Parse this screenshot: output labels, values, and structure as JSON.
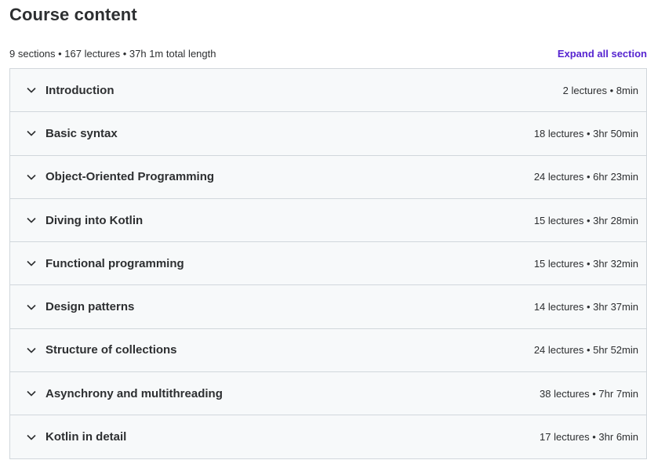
{
  "header": {
    "title": "Course content",
    "summary": "9 sections • 167 lectures • 37h 1m total length",
    "expand_label": "Expand all section"
  },
  "sections": [
    {
      "title": "Introduction",
      "meta": "2 lectures • 8min"
    },
    {
      "title": "Basic syntax",
      "meta": "18 lectures • 3hr 50min"
    },
    {
      "title": "Object-Oriented Programming",
      "meta": "24 lectures • 6hr 23min"
    },
    {
      "title": "Diving into Kotlin",
      "meta": "15 lectures • 3hr 28min"
    },
    {
      "title": "Functional programming",
      "meta": "15 lectures • 3hr 32min"
    },
    {
      "title": "Design patterns",
      "meta": "14 lectures • 3hr 37min"
    },
    {
      "title": "Structure of collections",
      "meta": "24 lectures • 5hr 52min"
    },
    {
      "title": "Asynchrony and multithreading",
      "meta": "38 lectures • 7hr 7min"
    },
    {
      "title": "Kotlin in detail",
      "meta": "17 lectures • 3hr 6min"
    }
  ],
  "colors": {
    "accent": "#5624d0",
    "section_bg": "#f7f9fa",
    "border": "#d1d7dc",
    "text": "#2d2f31"
  },
  "icons": {
    "expand_toggle": "chevron-down-icon"
  }
}
